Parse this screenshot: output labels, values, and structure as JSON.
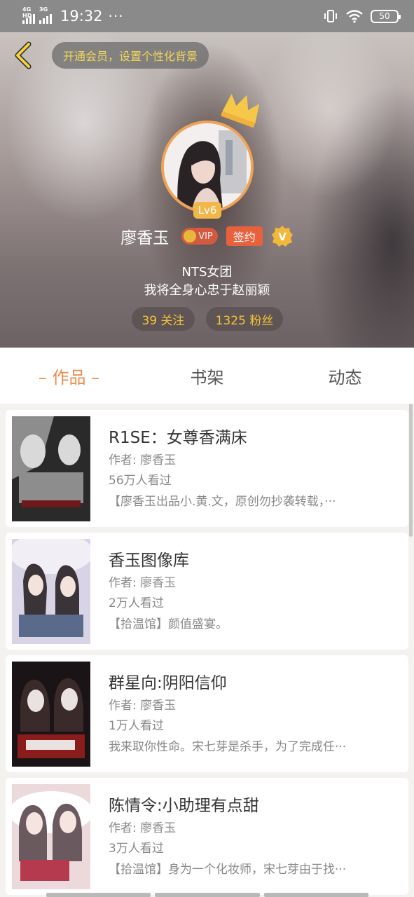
{
  "status_bar": {
    "network1": "4G HD",
    "network2": "3G",
    "time": "19:32",
    "dots": "···",
    "battery": "50"
  },
  "header": {
    "vip_prompt": "开通会员，设置个性化背景",
    "level": "Lv6",
    "username": "廖香玉",
    "vip_label": "VIP",
    "sign_label": "签约",
    "verified_mark": "V",
    "bio_line1": "NTS女团",
    "bio_line2": "我将全身心忠于赵丽颖",
    "following": "39 关注",
    "fans": "1325 粉丝"
  },
  "tabs": [
    {
      "label": "– 作品 –",
      "active": true
    },
    {
      "label": "书架",
      "active": false
    },
    {
      "label": "动态",
      "active": false
    }
  ],
  "books": [
    {
      "title": "R1SE：女尊香满床",
      "author": "作者: 廖香玉",
      "views": "56万人看过",
      "desc": "【廖香玉出品小.黄.文，原创勿抄袭转载，···",
      "cover_colors": [
        "#2a2a2a",
        "#8d8d8d",
        "#d9d9d9",
        "#6e1a1a"
      ]
    },
    {
      "title": "香玉图像库",
      "author": "作者: 廖香玉",
      "views": "2万人看过",
      "desc": "【拾温馆】颜值盛宴。",
      "cover_colors": [
        "#d9d3e6",
        "#f2eef5",
        "#3a3338",
        "#5a6a8a"
      ]
    },
    {
      "title": "群星向:阴阳信仰",
      "author": "作者: 廖香玉",
      "views": "1万人看过",
      "desc": "我来取你性命。宋七芽是杀手，为了完成任···",
      "cover_colors": [
        "#1b1416",
        "#e9e2e0",
        "#8a1c1c",
        "#3a2a2a"
      ]
    },
    {
      "title": "陈情令:小助理有点甜",
      "author": "作者: 廖香玉",
      "views": "3万人看过",
      "desc": "【拾温馆】身为一个化妆师，宋七芽由于找···",
      "cover_colors": [
        "#ecd9dc",
        "#ffffff",
        "#b63a4d",
        "#6a5a60"
      ]
    }
  ]
}
